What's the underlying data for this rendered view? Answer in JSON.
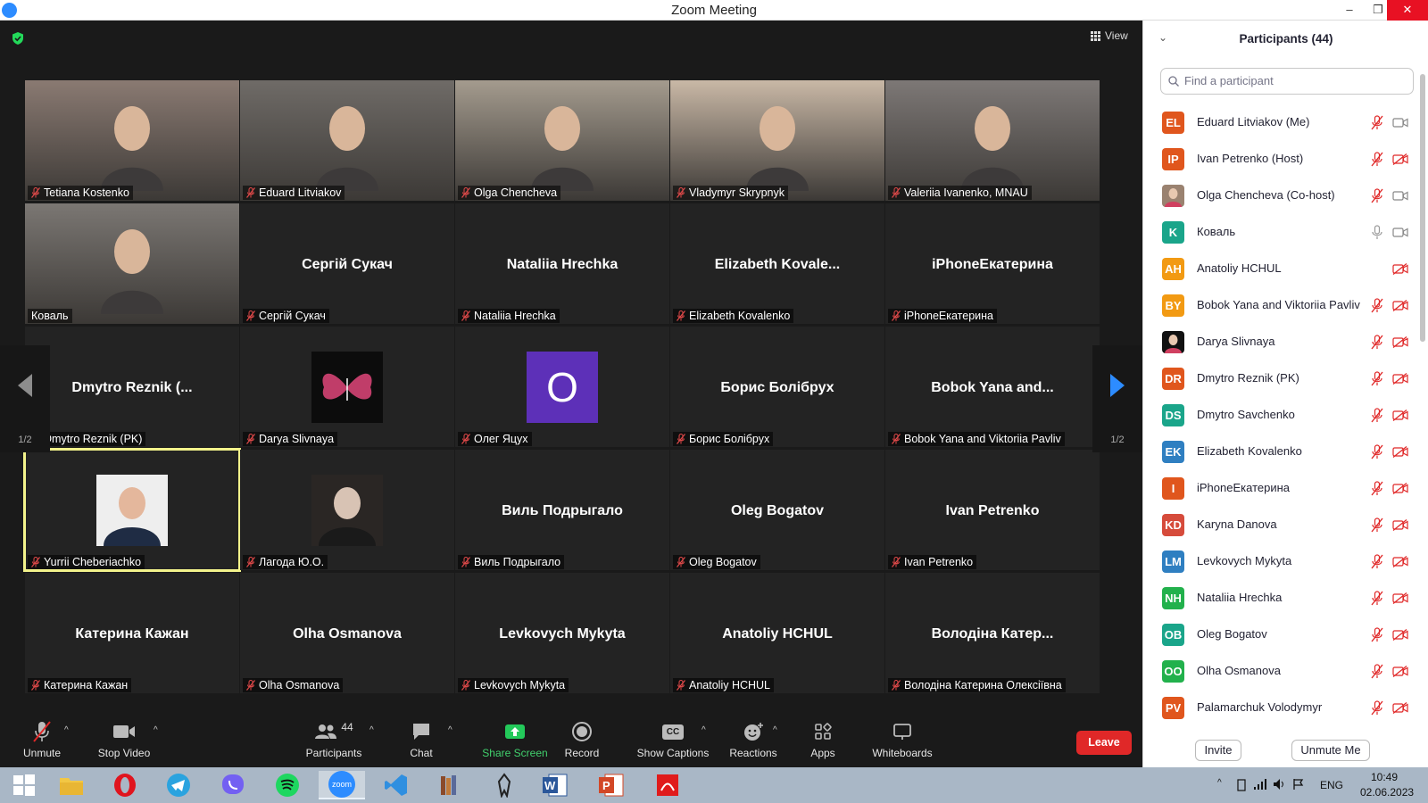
{
  "window": {
    "title": "Zoom Meeting",
    "min": "–",
    "restore": "❐",
    "close": "✕"
  },
  "view_label": "View",
  "tiles": [
    {
      "name": "Tetiana Kostenko",
      "big": "",
      "type": "video",
      "bg": "#8a7a72"
    },
    {
      "name": "Eduard Litviakov",
      "big": "",
      "type": "video",
      "bg": "#6f6b67"
    },
    {
      "name": "Olga Chencheva",
      "big": "",
      "type": "video",
      "bg": "#a49b8e"
    },
    {
      "name": "Vladymyr Skrypnyk",
      "big": "",
      "type": "video",
      "bg": "#c9b8a6"
    },
    {
      "name": "Valeriia Ivanenko, MNAU",
      "big": "",
      "type": "video",
      "bg": "#7d7876"
    },
    {
      "name": "Коваль",
      "big": "",
      "type": "video",
      "bg": "#7b7773",
      "nomic": true
    },
    {
      "name": "Сергій Сукач",
      "big": "Сергій Сукач",
      "type": "text"
    },
    {
      "name": "Nataliia Hrechka",
      "big": "Nataliia Hrechka",
      "type": "text"
    },
    {
      "name": "Elizabeth Kovalenko",
      "big": "Elizabeth  Kovale...",
      "type": "text"
    },
    {
      "name": "iPhoneЕкатерина",
      "big": "iPhoneЕкатерина",
      "type": "text"
    },
    {
      "name": "Dmytro Reznik (PK)",
      "big": "Dmytro Reznik (...",
      "type": "text"
    },
    {
      "name": "Darya Slivnaya",
      "big": "",
      "type": "butterfly"
    },
    {
      "name": "Олег Яцух",
      "big": "",
      "type": "letter",
      "letter": "О"
    },
    {
      "name": "Борис Болібрух",
      "big": "Борис Болібрух",
      "type": "text"
    },
    {
      "name": "Bobok Yana and  Viktoriia Pavliv",
      "big": "Bobok Yana  and...",
      "type": "text"
    },
    {
      "name": "Yurrii Cheberiachko",
      "big": "",
      "type": "photo",
      "active": true
    },
    {
      "name": "Лагода Ю.О.",
      "big": "",
      "type": "photo2"
    },
    {
      "name": "Виль Подрыгало",
      "big": "Виль Подрыгало",
      "type": "text"
    },
    {
      "name": "Oleg Bogatov",
      "big": "Oleg Bogatov",
      "type": "text"
    },
    {
      "name": "Ivan Petrenko",
      "big": "Ivan Petrenko",
      "type": "text"
    },
    {
      "name": "Катерина Кажан",
      "big": "Катерина Кажан",
      "type": "text"
    },
    {
      "name": "Olha Osmanova",
      "big": "Olha Osmanova",
      "type": "text"
    },
    {
      "name": "Levkovych Mykyta",
      "big": "Levkovych Mykyta",
      "type": "text"
    },
    {
      "name": "Anatoliy HCHUL",
      "big": "Anatoliy HCHUL",
      "type": "text"
    },
    {
      "name": "Володіна Катерина Олексіївна",
      "big": "Володіна  Катер...",
      "type": "text"
    }
  ],
  "pager": {
    "left": "1/2",
    "right": "1/2"
  },
  "toolbar": {
    "unmute": "Unmute",
    "stop_video": "Stop Video",
    "participants": "Participants",
    "participants_count": "44",
    "chat": "Chat",
    "share_screen": "Share Screen",
    "record": "Record",
    "show_captions": "Show Captions",
    "cc": "CC",
    "reactions": "Reactions",
    "apps": "Apps",
    "whiteboards": "Whiteboards",
    "leave": "Leave"
  },
  "panel": {
    "title": "Participants (44)",
    "search_placeholder": "Find a participant",
    "invite": "Invite",
    "unmute_me": "Unmute Me",
    "participants": [
      {
        "initials": "EL",
        "name": "Eduard Litviakov (Me)",
        "color": "#e0561d",
        "mic": "muted",
        "cam": "on"
      },
      {
        "initials": "IP",
        "name": "Ivan Petrenko (Host)",
        "color": "#e0561d",
        "mic": "muted",
        "cam": "off"
      },
      {
        "initials": "",
        "name": "Olga Chencheva (Co-host)",
        "color": "#9a8270",
        "mic": "muted",
        "cam": "on",
        "photo": true
      },
      {
        "initials": "K",
        "name": "Коваль",
        "color": "#1aa58a",
        "mic": "on",
        "cam": "on"
      },
      {
        "initials": "AH",
        "name": "Anatoliy HCHUL",
        "color": "#f29a13",
        "mic": "none",
        "cam": "off"
      },
      {
        "initials": "BY",
        "name": "Bobok Yana and  Viktoriia Pavliv",
        "color": "#f29a13",
        "mic": "muted",
        "cam": "off"
      },
      {
        "initials": "",
        "name": "Darya Slivnaya",
        "color": "#111111",
        "mic": "muted",
        "cam": "off",
        "photo": true
      },
      {
        "initials": "DR",
        "name": "Dmytro Reznik (PK)",
        "color": "#e0561d",
        "mic": "muted",
        "cam": "off"
      },
      {
        "initials": "DS",
        "name": "Dmytro Savchenko",
        "color": "#1aa58a",
        "mic": "muted",
        "cam": "off"
      },
      {
        "initials": "EK",
        "name": "Elizabeth Kovalenko",
        "color": "#2f7fc1",
        "mic": "muted",
        "cam": "off"
      },
      {
        "initials": "I",
        "name": "iPhoneЕкатерина",
        "color": "#e0561d",
        "mic": "muted",
        "cam": "off"
      },
      {
        "initials": "KD",
        "name": "Karyna Danova",
        "color": "#d64b3b",
        "mic": "muted",
        "cam": "off"
      },
      {
        "initials": "LM",
        "name": "Levkovych Mykyta",
        "color": "#2f7fc1",
        "mic": "muted",
        "cam": "off"
      },
      {
        "initials": "NH",
        "name": "Nataliia Hrechka",
        "color": "#22b14c",
        "mic": "muted",
        "cam": "off"
      },
      {
        "initials": "OB",
        "name": "Oleg Bogatov",
        "color": "#1aa58a",
        "mic": "muted",
        "cam": "off"
      },
      {
        "initials": "OO",
        "name": "Olha Osmanova",
        "color": "#22b14c",
        "mic": "muted",
        "cam": "off"
      },
      {
        "initials": "PV",
        "name": "Palamarchuk Volodymyr",
        "color": "#e0561d",
        "mic": "muted",
        "cam": "off"
      }
    ]
  },
  "taskbar": {
    "apps": [
      "start",
      "file-explorer",
      "opera",
      "telegram",
      "viber",
      "spotify",
      "zoom",
      "vscode",
      "library",
      "skyrim",
      "word",
      "powerpoint",
      "acrobat"
    ],
    "zoom_label": "zoom",
    "language": "ENG",
    "time": "10:49",
    "date": "02.06.2023"
  }
}
